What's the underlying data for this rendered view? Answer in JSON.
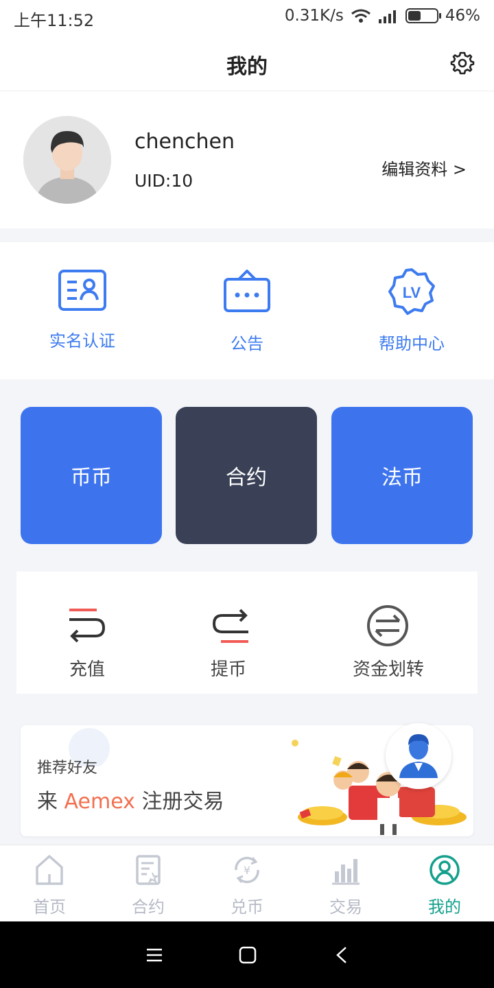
{
  "status_bar": {
    "time": "上午11:52",
    "speed": "0.31K/s",
    "battery": "46%",
    "battery_level": 0.46
  },
  "header": {
    "title": "我的",
    "settings_icon": "gear-icon"
  },
  "profile": {
    "username": "chenchen",
    "uid": "UID:10",
    "edit_label": "编辑资料 >"
  },
  "quick_links": [
    {
      "label": "实名认证",
      "icon": "id-card-icon"
    },
    {
      "label": "公告",
      "icon": "announcement-icon"
    },
    {
      "label": "帮助中心",
      "icon": "help-badge-icon",
      "icon_text": "LV"
    }
  ],
  "accounts": [
    {
      "label": "币币",
      "color": "#3d74ee"
    },
    {
      "label": "合约",
      "color": "#3a4156"
    },
    {
      "label": "法币",
      "color": "#3d74ee"
    }
  ],
  "funds": [
    {
      "label": "充值",
      "icon": "deposit-icon"
    },
    {
      "label": "提币",
      "icon": "withdraw-icon"
    },
    {
      "label": "资金划转",
      "icon": "transfer-icon"
    }
  ],
  "banner": {
    "small": "推荐好友",
    "prefix": "来",
    "brand": "Aemex",
    "suffix": "注册交易"
  },
  "tabs": [
    {
      "label": "首页",
      "icon": "home-icon"
    },
    {
      "label": "合约",
      "icon": "contract-icon"
    },
    {
      "label": "兑币",
      "icon": "exchange-icon"
    },
    {
      "label": "交易",
      "icon": "chart-icon"
    },
    {
      "label": "我的",
      "icon": "user-icon",
      "active": true
    }
  ],
  "colors": {
    "accent": "#3d7bf0",
    "active_tab": "#14a08c",
    "brand_highlight": "#f26f4f"
  }
}
